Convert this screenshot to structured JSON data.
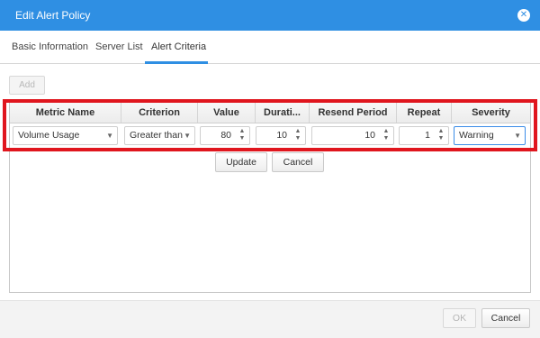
{
  "dialog": {
    "title": "Edit Alert Policy"
  },
  "tabs": [
    {
      "label": "Basic Information"
    },
    {
      "label": "Server List"
    },
    {
      "label": "Alert Criteria"
    }
  ],
  "toolbar": {
    "add_label": "Add"
  },
  "grid": {
    "columns": [
      "Metric Name",
      "Criterion",
      "Value",
      "Durati...",
      "Resend Period",
      "Repeat",
      "Severity"
    ],
    "row": {
      "metric_name": "Volume Usage",
      "criterion": "Greater than",
      "value": "80",
      "duration": "10",
      "resend_period": "10",
      "repeat": "1",
      "severity": "Warning"
    }
  },
  "row_actions": {
    "update_label": "Update",
    "cancel_label": "Cancel"
  },
  "footer": {
    "ok_label": "OK",
    "cancel_label": "Cancel"
  },
  "colors": {
    "accent": "#2f8fe3",
    "highlight": "#e0161e"
  },
  "icons": {
    "close": "close-circle-icon",
    "dropdown": "chevron-down-icon",
    "spinner": "spinner-arrows-icon"
  }
}
